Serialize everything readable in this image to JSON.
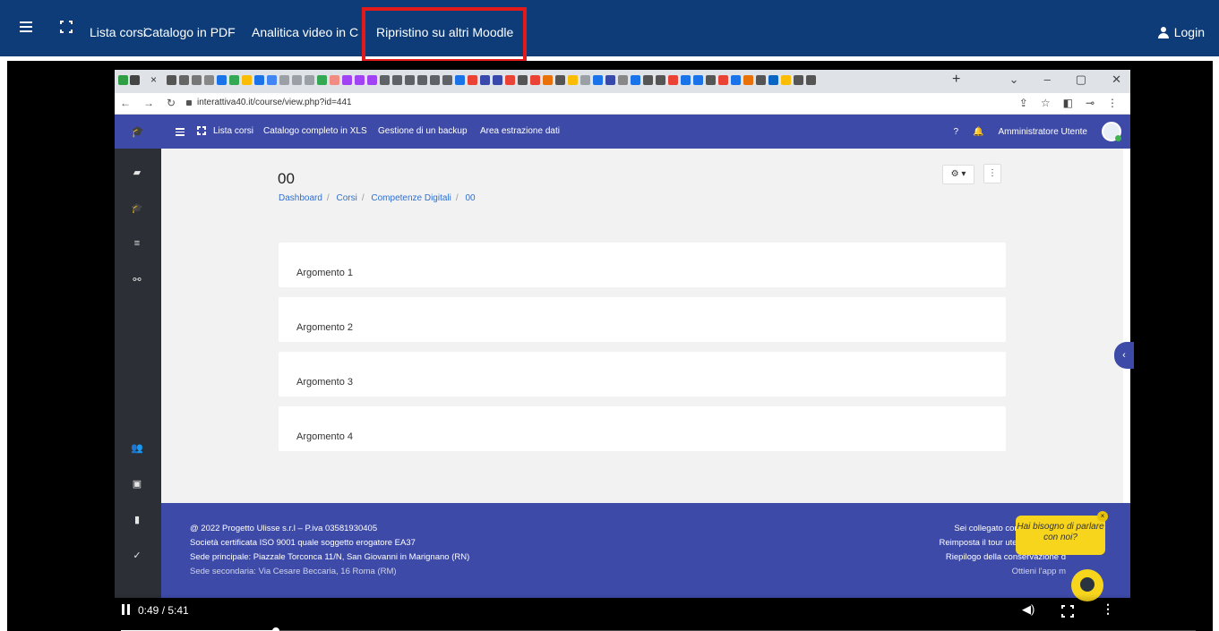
{
  "site_nav": {
    "links": [
      "Lista corsi",
      "Catalogo in PDF",
      "Analitica video in CSV",
      "Ripristino su altri Moodle"
    ],
    "login": "Login",
    "bg_color": "#0d3c78",
    "highlight_color": "#e31a1a"
  },
  "browser": {
    "url": "interattiva40.it/course/view.php?id=441"
  },
  "moodle_nav": {
    "links": [
      "Lista corsi",
      "Catalogo completo in XLS",
      "Gestione di un backup",
      "Area estrazione dati"
    ],
    "user": "Amministratore Utente",
    "bg_color": "#3d4aa8"
  },
  "course": {
    "title": "00",
    "breadcrumb": [
      "Dashboard",
      "Corsi",
      "Competenze Digitali",
      "00"
    ],
    "sections": [
      "Argomento 1",
      "Argomento 2",
      "Argomento 3",
      "Argomento 4"
    ]
  },
  "footer": {
    "left_lines": [
      "@ 2022 Progetto Ulisse s.r.l – P.iva 03581930405",
      "Società certificata ISO 9001 quale soggetto erogatore EA37",
      "Sede principale: Piazzale Torconca 11/N, San Giovanni in Marignano (RN)",
      "Sede secondaria: Via Cesare Beccaria, 16 Roma (RM)"
    ],
    "right_lines": [
      "Sei collegato come Amministr",
      "Reimposta il tour utente in questa",
      "Riepilogo della conservazione d",
      "Ottieni l'app m"
    ]
  },
  "chat": {
    "text": "Hai bisogno di parlare con noi?"
  },
  "video": {
    "time": "0:49 / 5:41",
    "progress_fraction": 0.144
  }
}
